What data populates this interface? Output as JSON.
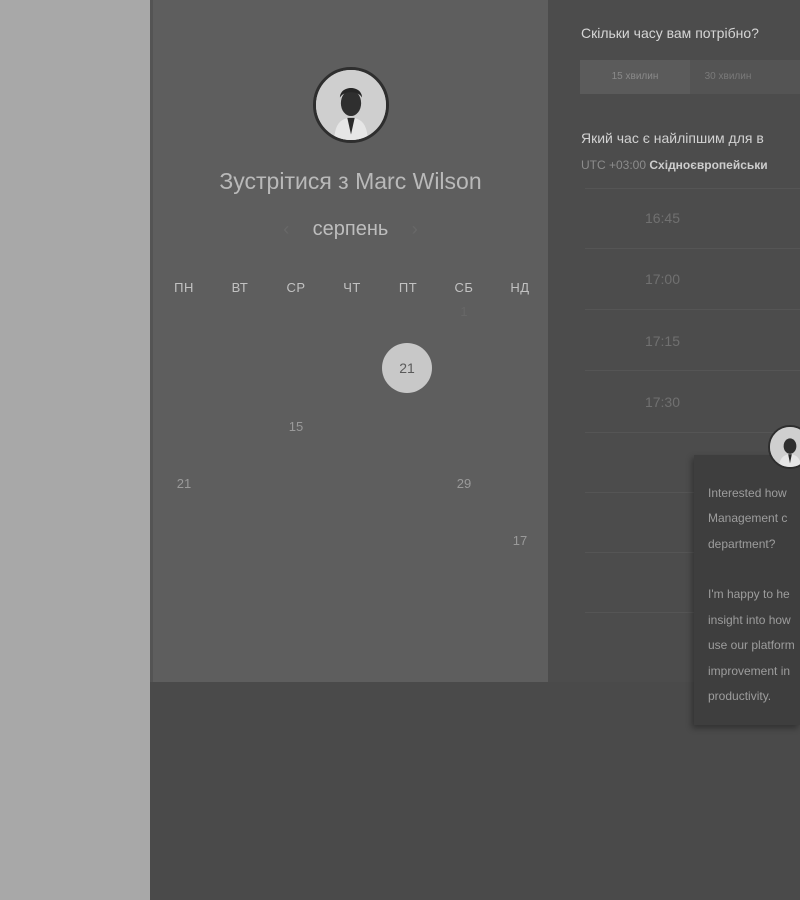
{
  "scheduler": {
    "title": "Зустрітися з Marc Wilson",
    "month": "серпень",
    "prev_icon": "‹",
    "next_icon": "›",
    "weekdays": [
      "ПН",
      "ВТ",
      "СР",
      "ЧТ",
      "ПТ",
      "СБ",
      "НД"
    ],
    "days": {
      "r0_sat": "1",
      "r1_fri_selected": "21",
      "r2_wed": "15",
      "r3_mon": "21",
      "r3_sat": "29",
      "r4_sun": "17"
    }
  },
  "duration": {
    "question": "Скільки часу вам потрібно?",
    "options": [
      "15 хвилин",
      "30 хвилин"
    ]
  },
  "timeslots": {
    "question": "Який час є найліпшим для в",
    "timezone_offset": "UTC +03:00",
    "timezone_name": "Східноєвропейськи",
    "slots": [
      "16:45",
      "17:00",
      "17:15",
      "17:30"
    ]
  },
  "chat": {
    "lines": [
      "Interested how",
      "Management c",
      "department?",
      "I'm happy to he",
      "insight into how",
      "use our platform",
      "improvement in",
      "productivity."
    ]
  }
}
